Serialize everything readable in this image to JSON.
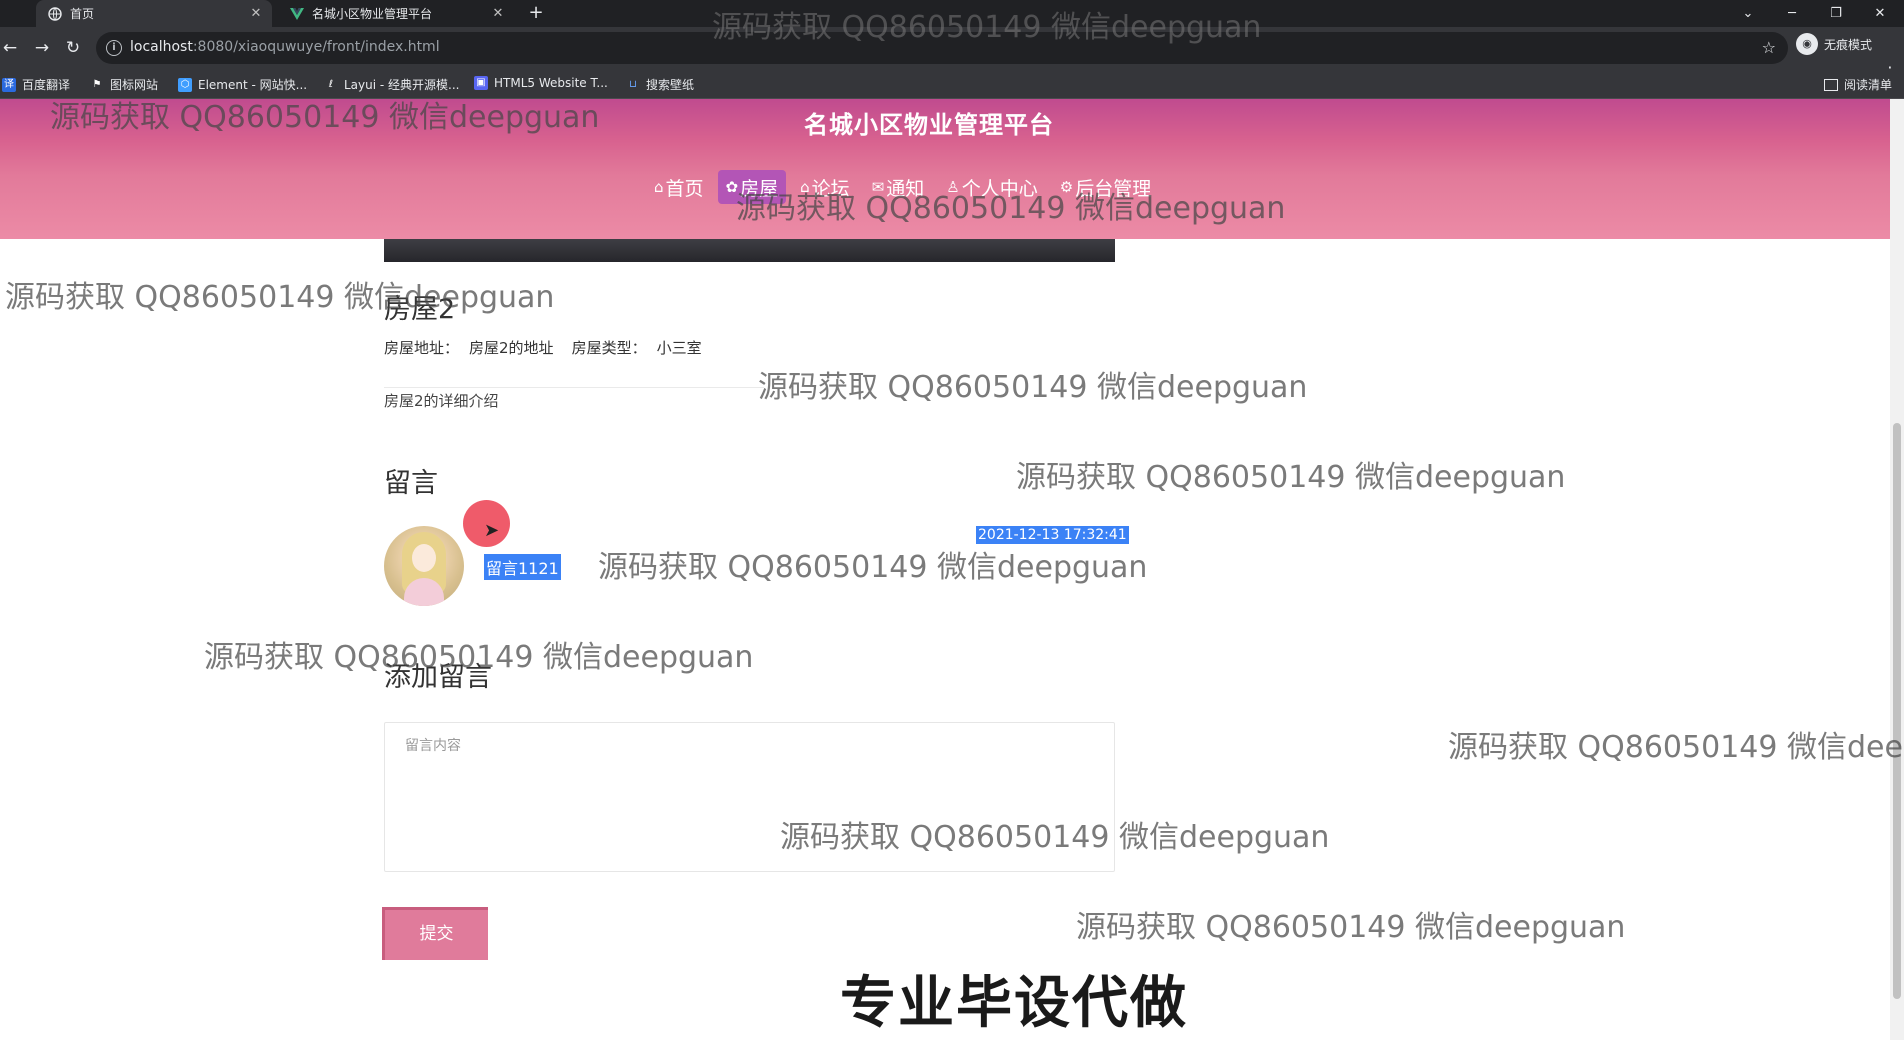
{
  "browser": {
    "tabs": [
      {
        "title": "首页",
        "active": true
      },
      {
        "title": "名城小区物业管理平台",
        "active": false
      }
    ],
    "url_host": "localhost",
    "url_path": ":8080/xiaoquwuye/front/index.html",
    "incognito_label": "无痕模式",
    "bookmarks": [
      "百度翻译",
      "图标网站",
      "Element - 网站快...",
      "Layui - 经典开源模...",
      "HTML5 Website T...",
      "搜索壁纸"
    ],
    "reading_list": "阅读清单"
  },
  "site": {
    "title": "名城小区物业管理平台",
    "nav": [
      {
        "icon": "⌂",
        "label": "首页"
      },
      {
        "icon": "✿",
        "label": "房屋"
      },
      {
        "icon": "⌂",
        "label": "论坛"
      },
      {
        "icon": "✉",
        "label": "通知"
      },
      {
        "icon": "♙",
        "label": "个人中心"
      },
      {
        "icon": "⚙",
        "label": "后台管理"
      }
    ],
    "active_nav": "房屋"
  },
  "house": {
    "name": "房屋2",
    "address_label": "房屋地址：",
    "address": "房屋2的地址",
    "type_label": "房屋类型：",
    "type": "小三室",
    "description": "房屋2的详细介绍"
  },
  "comments": {
    "heading": "留言",
    "items": [
      {
        "text": "留言1121",
        "time": "2021-12-13 17:32:41"
      }
    ]
  },
  "add_comment": {
    "heading": "添加留言",
    "placeholder": "留言内容",
    "submit_label": "提交"
  },
  "overlay": {
    "watermark": "源码获取 QQ86050149 微信deepguan",
    "caption": "专业毕设代做"
  }
}
